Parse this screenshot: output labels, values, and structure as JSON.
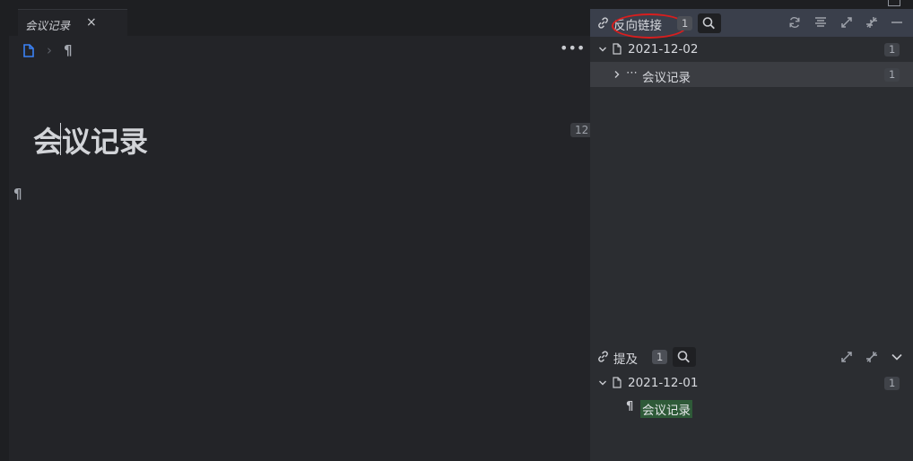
{
  "tab": {
    "title": "会议记录",
    "close": "×"
  },
  "breadcrumb": {
    "separator": "›",
    "paragraph": "¶"
  },
  "editor": {
    "more": "•••",
    "title": "会议记录",
    "word_count": "12",
    "paragraph_mark": "¶"
  },
  "backlinks": {
    "title": "反向链接",
    "count": "1",
    "items": [
      {
        "date": "2021-12-02",
        "count": "1",
        "children": [
          {
            "prefix": "⋯",
            "text": "会议记录",
            "count": "1"
          }
        ]
      }
    ]
  },
  "mentions": {
    "title": "提及",
    "count": "1",
    "items": [
      {
        "date": "2021-12-01",
        "count": "1",
        "children": [
          {
            "prefix": "¶",
            "text": "会议记录"
          }
        ]
      }
    ]
  },
  "colors": {
    "accent": "#3b82f6",
    "annotation": "#d81e1e",
    "highlight": "#2e5a38"
  }
}
